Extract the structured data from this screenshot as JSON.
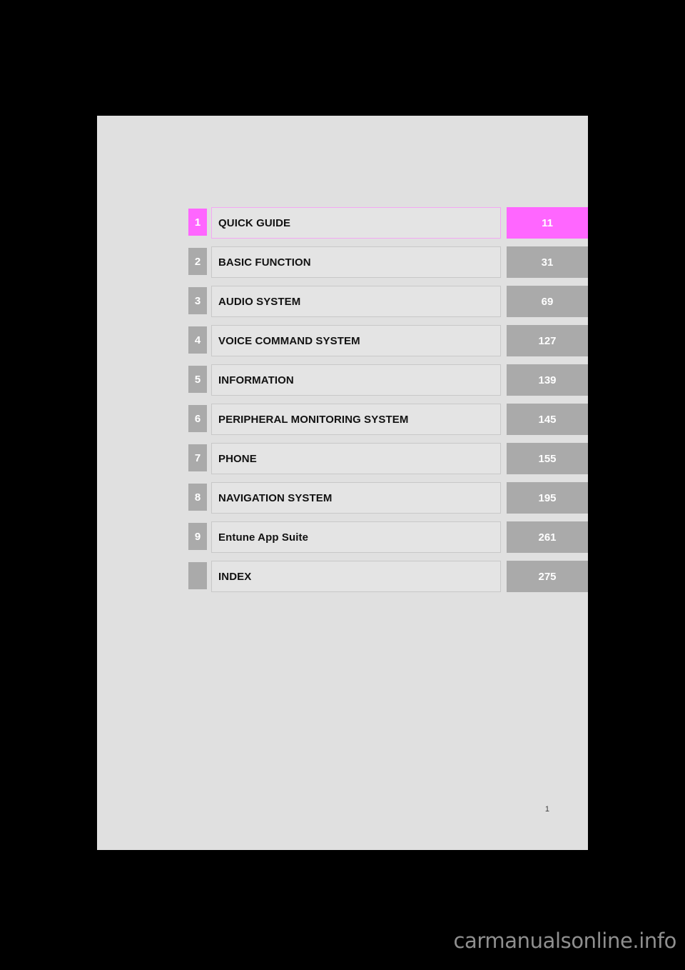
{
  "document": {
    "type": "vehicle-manual-table-of-contents",
    "folio": "1",
    "watermark": "carmanualsonline.info",
    "colors": {
      "page_background": "#e0e0e0",
      "tab_gray": "#aaaaaa",
      "title_box": "#e4e4e4",
      "highlight_magenta": "#ff66ff",
      "highlight_border": "#f3a8f3",
      "text": "#121212"
    }
  },
  "toc": {
    "rows": [
      {
        "number": "1",
        "title": "QUICK GUIDE",
        "page": "11",
        "highlight": true
      },
      {
        "number": "2",
        "title": "BASIC FUNCTION",
        "page": "31",
        "highlight": false
      },
      {
        "number": "3",
        "title": "AUDIO SYSTEM",
        "page": "69",
        "highlight": false
      },
      {
        "number": "4",
        "title": "VOICE COMMAND SYSTEM",
        "page": "127",
        "highlight": false
      },
      {
        "number": "5",
        "title": "INFORMATION",
        "page": "139",
        "highlight": false
      },
      {
        "number": "6",
        "title": "PERIPHERAL MONITORING SYSTEM",
        "page": "145",
        "highlight": false
      },
      {
        "number": "7",
        "title": "PHONE",
        "page": "155",
        "highlight": false
      },
      {
        "number": "8",
        "title": "NAVIGATION SYSTEM",
        "page": "195",
        "highlight": false
      },
      {
        "number": "9",
        "title": "Entune App Suite",
        "page": "261",
        "highlight": false
      },
      {
        "number": "",
        "title": "INDEX",
        "page": "275",
        "highlight": false
      }
    ]
  }
}
